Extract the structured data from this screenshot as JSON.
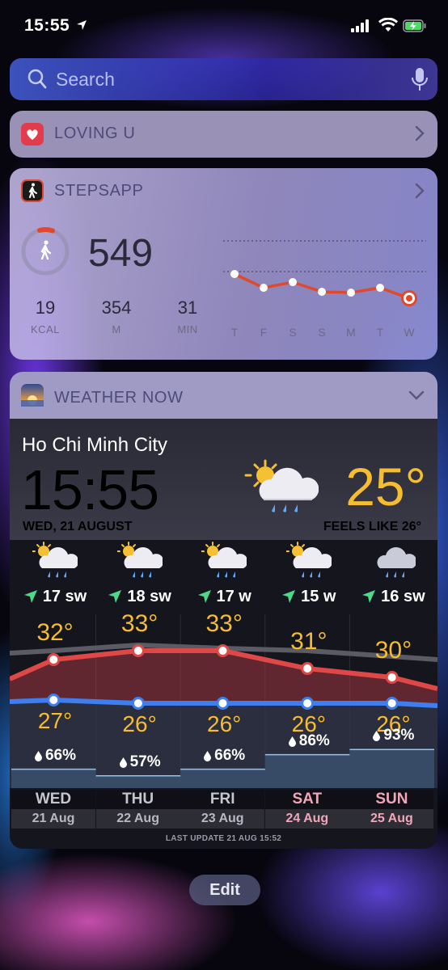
{
  "status_bar": {
    "time": "15:55"
  },
  "search": {
    "placeholder": "Search"
  },
  "loving_widget": {
    "title": "LOVING U"
  },
  "steps_widget": {
    "title": "STEPSAPP",
    "steps": "549",
    "stats": [
      {
        "value": "19",
        "label": "KCAL"
      },
      {
        "value": "354",
        "label": "M"
      },
      {
        "value": "31",
        "label": "MIN"
      }
    ],
    "chart_days": [
      "T",
      "F",
      "S",
      "S",
      "M",
      "T",
      "W"
    ],
    "accent_color": "#e1492c"
  },
  "weather_widget": {
    "title": "WEATHER NOW",
    "city": "Ho Chi Minh City",
    "time": "15:55",
    "date": "WED, 21 AUGUST",
    "temp": "25°",
    "feels_like": "FEELS LIKE  26°",
    "forecast": [
      {
        "wind": "17 sw",
        "high": "32°",
        "low": "27°",
        "humidity": "66%",
        "day": "WED",
        "date": "21 Aug",
        "icon": "partly-cloudy-rain-icon"
      },
      {
        "wind": "18 sw",
        "high": "33°",
        "low": "26°",
        "humidity": "57%",
        "day": "THU",
        "date": "22 Aug",
        "icon": "partly-cloudy-rain-icon"
      },
      {
        "wind": "17 w",
        "high": "33°",
        "low": "26°",
        "humidity": "66%",
        "day": "FRI",
        "date": "23 Aug",
        "icon": "partly-cloudy-rain-icon"
      },
      {
        "wind": "15 w",
        "high": "31°",
        "low": "26°",
        "humidity": "86%",
        "day": "SAT",
        "date": "24 Aug",
        "icon": "partly-cloudy-rain-icon"
      },
      {
        "wind": "16 sw",
        "high": "30°",
        "low": "26°",
        "humidity": "93%",
        "day": "SUN",
        "date": "25 Aug",
        "icon": "cloud-rain-icon"
      }
    ],
    "last_update": "LAST UPDATE 21 AUG 15:52",
    "colors": {
      "high": "#e04848",
      "low": "#3d7ff0",
      "temp_text": "#f6bd2e",
      "weekend": "#f1a6b7"
    }
  },
  "edit_button": {
    "label": "Edit"
  }
}
